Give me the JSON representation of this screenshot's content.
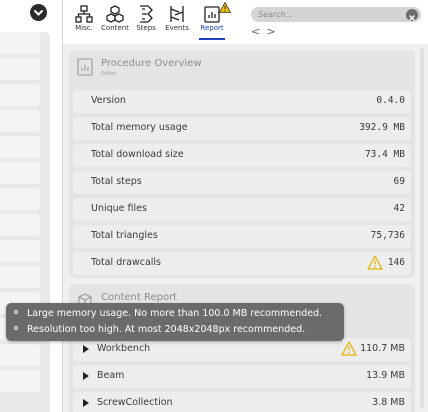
{
  "toolbar": {
    "tabs": [
      {
        "label": "Misc.",
        "icon": "misc-icon"
      },
      {
        "label": "Content",
        "icon": "content-icon"
      },
      {
        "label": "Steps",
        "icon": "steps-icon"
      },
      {
        "label": "Events",
        "icon": "events-icon"
      },
      {
        "label": "Report",
        "icon": "report-icon",
        "active": true,
        "warning": true
      }
    ],
    "accent_color": "#1c3fbf"
  },
  "search": {
    "placeholder": "Search..."
  },
  "nav": {
    "back": "<",
    "forward": ">"
  },
  "procedure_overview": {
    "title": "Procedure Overview",
    "subtitle": "Editor",
    "rows": [
      {
        "label": "Version",
        "value": "0.4.0"
      },
      {
        "label": "Total memory usage",
        "value": "392.9 MB"
      },
      {
        "label": "Total download size",
        "value": "73.4 MB"
      },
      {
        "label": "Total steps",
        "value": "69"
      },
      {
        "label": "Unique files",
        "value": "42"
      },
      {
        "label": "Total triangles",
        "value": "75,736"
      },
      {
        "label": "Total drawcalls",
        "value": "146",
        "warning": true
      }
    ]
  },
  "content_report": {
    "title": "Content Report",
    "rows": [
      {
        "label": "Workbench",
        "value": "110.7 MB",
        "warning": true
      },
      {
        "label": "Beam",
        "value": "13.9 MB"
      },
      {
        "label": "ScrewCollection",
        "value": "3.8 MB"
      }
    ]
  },
  "tooltip": {
    "lines": [
      "Large memory usage. No more than 100.0 MB recommended.",
      "Resolution too high. At most 2048x2048px recommended."
    ]
  },
  "colors": {
    "warning": "#e8b400",
    "panel_bg": "#f0f0f0",
    "card_bg": "#e4e4e4",
    "tooltip_bg": "#6b6b6b"
  }
}
